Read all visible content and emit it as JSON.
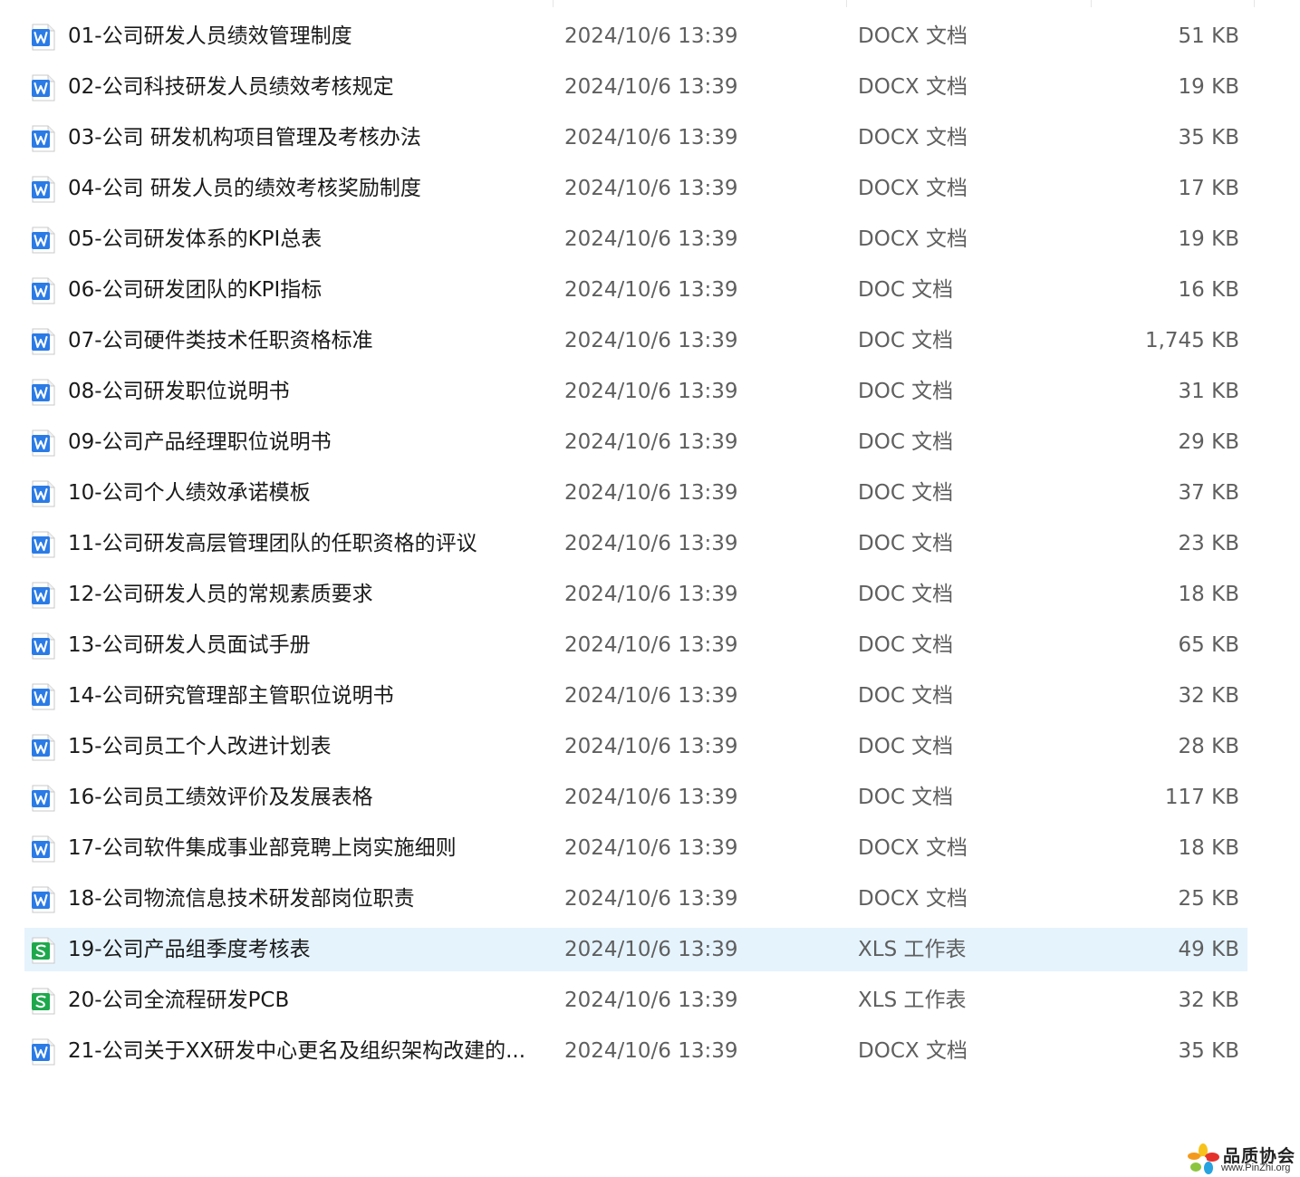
{
  "colors": {
    "word_icon": "#2b7be6",
    "excel_icon": "#1ea84c",
    "selected_row": "#e5f3fd"
  },
  "files": [
    {
      "name": "01-公司研发人员绩效管理制度",
      "date": "2024/10/6 13:39",
      "type": "DOCX 文档",
      "size": "51 KB",
      "icon": "word-icon"
    },
    {
      "name": "02-公司科技研发人员绩效考核规定",
      "date": "2024/10/6 13:39",
      "type": "DOCX 文档",
      "size": "19 KB",
      "icon": "word-icon"
    },
    {
      "name": "03-公司 研发机构项目管理及考核办法",
      "date": "2024/10/6 13:39",
      "type": "DOCX 文档",
      "size": "35 KB",
      "icon": "word-icon"
    },
    {
      "name": "04-公司 研发人员的绩效考核奖励制度",
      "date": "2024/10/6 13:39",
      "type": "DOCX 文档",
      "size": "17 KB",
      "icon": "word-icon"
    },
    {
      "name": "05-公司研发体系的KPI总表",
      "date": "2024/10/6 13:39",
      "type": "DOCX 文档",
      "size": "19 KB",
      "icon": "word-icon"
    },
    {
      "name": "06-公司研发团队的KPI指标",
      "date": "2024/10/6 13:39",
      "type": "DOC 文档",
      "size": "16 KB",
      "icon": "word-icon"
    },
    {
      "name": "07-公司硬件类技术任职资格标准",
      "date": "2024/10/6 13:39",
      "type": "DOC 文档",
      "size": "1,745 KB",
      "icon": "word-icon"
    },
    {
      "name": "08-公司研发职位说明书",
      "date": "2024/10/6 13:39",
      "type": "DOC 文档",
      "size": "31 KB",
      "icon": "word-icon"
    },
    {
      "name": "09-公司产品经理职位说明书",
      "date": "2024/10/6 13:39",
      "type": "DOC 文档",
      "size": "29 KB",
      "icon": "word-icon"
    },
    {
      "name": "10-公司个人绩效承诺模板",
      "date": "2024/10/6 13:39",
      "type": "DOC 文档",
      "size": "37 KB",
      "icon": "word-icon"
    },
    {
      "name": "11-公司研发高层管理团队的任职资格的评议",
      "date": "2024/10/6 13:39",
      "type": "DOC 文档",
      "size": "23 KB",
      "icon": "word-icon"
    },
    {
      "name": "12-公司研发人员的常规素质要求",
      "date": "2024/10/6 13:39",
      "type": "DOC 文档",
      "size": "18 KB",
      "icon": "word-icon"
    },
    {
      "name": "13-公司研发人员面试手册",
      "date": "2024/10/6 13:39",
      "type": "DOC 文档",
      "size": "65 KB",
      "icon": "word-icon"
    },
    {
      "name": "14-公司研究管理部主管职位说明书",
      "date": "2024/10/6 13:39",
      "type": "DOC 文档",
      "size": "32 KB",
      "icon": "word-icon"
    },
    {
      "name": "15-公司员工个人改进计划表",
      "date": "2024/10/6 13:39",
      "type": "DOC 文档",
      "size": "28 KB",
      "icon": "word-icon"
    },
    {
      "name": "16-公司员工绩效评价及发展表格",
      "date": "2024/10/6 13:39",
      "type": "DOC 文档",
      "size": "117 KB",
      "icon": "word-icon"
    },
    {
      "name": "17-公司软件集成事业部竞聘上岗实施细则",
      "date": "2024/10/6 13:39",
      "type": "DOCX 文档",
      "size": "18 KB",
      "icon": "word-icon"
    },
    {
      "name": "18-公司物流信息技术研发部岗位职责",
      "date": "2024/10/6 13:39",
      "type": "DOCX 文档",
      "size": "25 KB",
      "icon": "word-icon"
    },
    {
      "name": "19-公司产品组季度考核表",
      "date": "2024/10/6 13:39",
      "type": "XLS 工作表",
      "size": "49 KB",
      "icon": "excel-icon",
      "selected": true
    },
    {
      "name": "20-公司全流程研发PCB",
      "date": "2024/10/6 13:39",
      "type": "XLS 工作表",
      "size": "32 KB",
      "icon": "excel-icon"
    },
    {
      "name": "21-公司关于XX研发中心更名及组织架构改建的...",
      "date": "2024/10/6 13:39",
      "type": "DOCX 文档",
      "size": "35 KB",
      "icon": "word-icon"
    }
  ],
  "watermark": {
    "title": "品质协会",
    "url": "www.PinZhi.org"
  }
}
